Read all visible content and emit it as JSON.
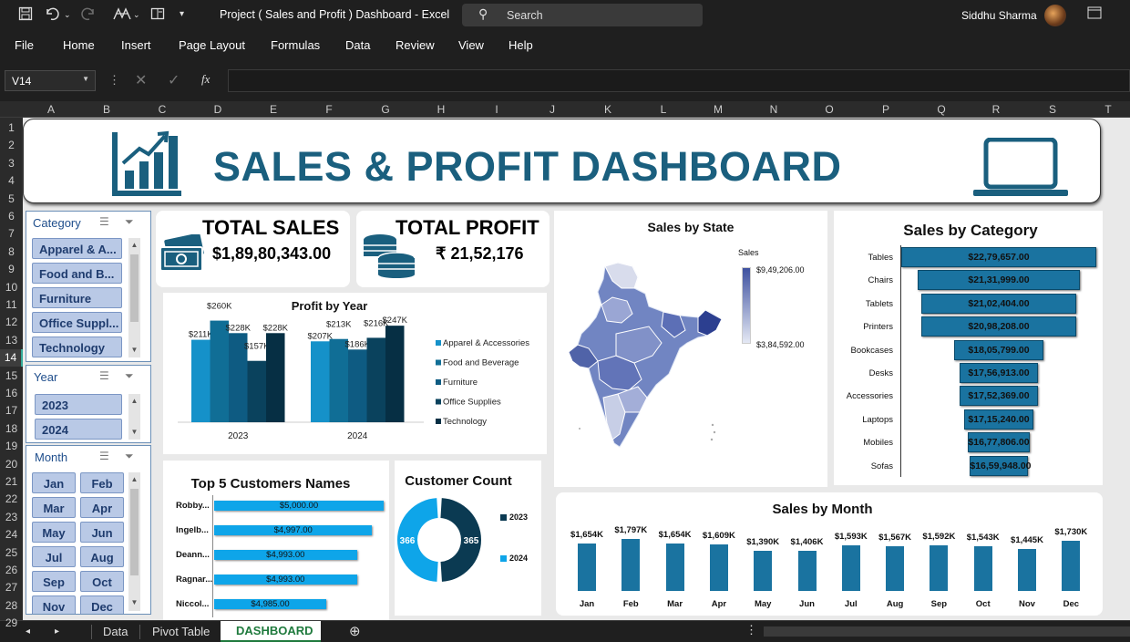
{
  "window": {
    "title": "Project ( Sales and Profit ) Dashboard  -  Excel",
    "search_label": "Search",
    "user_name": "Siddhu Sharma"
  },
  "menu": [
    "File",
    "Home",
    "Insert",
    "Page Layout",
    "Formulas",
    "Data",
    "Review",
    "View",
    "Help"
  ],
  "formula_bar": {
    "name_box": "V14",
    "fx_label": "fx",
    "formula": ""
  },
  "columns": [
    "A",
    "B",
    "C",
    "D",
    "E",
    "F",
    "G",
    "H",
    "I",
    "J",
    "K",
    "L",
    "M",
    "N",
    "O",
    "P",
    "Q",
    "R",
    "S",
    "T"
  ],
  "rows": [
    "1",
    "2",
    "3",
    "4",
    "5",
    "6",
    "7",
    "8",
    "9",
    "10",
    "11",
    "12",
    "13",
    "14",
    "15",
    "16",
    "17",
    "18",
    "19",
    "20",
    "21",
    "22",
    "23",
    "24",
    "25",
    "26",
    "27",
    "28",
    "29"
  ],
  "selected_row": "14",
  "dashboard": {
    "title": "SALES & PROFIT DASHBOARD",
    "total_sales": {
      "label": "TOTAL SALES",
      "value": "$1,89,80,343.00"
    },
    "total_profit": {
      "label": "TOTAL PROFIT",
      "value": "₹ 21,52,176"
    }
  },
  "slicers": {
    "category": {
      "title": "Category",
      "items": [
        "Apparel & A...",
        "Food and B...",
        "Furniture",
        "Office Suppl...",
        "Technology"
      ]
    },
    "year": {
      "title": "Year",
      "items": [
        "2023",
        "2024"
      ]
    },
    "month": {
      "title": "Month",
      "items": [
        "Jan",
        "Feb",
        "Mar",
        "Apr",
        "May",
        "Jun",
        "Jul",
        "Aug",
        "Sep",
        "Oct",
        "Nov",
        "Dec"
      ]
    }
  },
  "colors": {
    "brand": "#1a5f7e",
    "s1": "#1591c9",
    "s2": "#106e96",
    "s3": "#0e5b82",
    "s4": "#0a425d",
    "s5": "#062f44",
    "cat_bar": "#1a73a0",
    "light": "#0ea5e9",
    "dark": "#0b3a52"
  },
  "chart_data": [
    {
      "type": "bar",
      "title": "Profit by Year",
      "categories": [
        "2023",
        "2024"
      ],
      "series": [
        {
          "name": "Apparel & Accessories",
          "values": [
            211,
            207
          ]
        },
        {
          "name": "Food and Beverage",
          "values": [
            260,
            213
          ]
        },
        {
          "name": "Furniture",
          "values": [
            228,
            186
          ]
        },
        {
          "name": "Office Supplies",
          "values": [
            157,
            216
          ]
        },
        {
          "name": "Technology",
          "values": [
            228,
            247
          ]
        }
      ],
      "data_labels": [
        [
          "$211K",
          "$260K",
          "$228K",
          "$157K",
          "$228K"
        ],
        [
          "$207K",
          "$213K",
          "$186K",
          "$216K",
          "$247K"
        ]
      ],
      "ylim": [
        0,
        280
      ]
    },
    {
      "type": "map",
      "title": "Sales by State",
      "legend_title": "Sales",
      "legend_max": "$9,49,206.00",
      "legend_min": "$3,84,592.00"
    },
    {
      "type": "bar",
      "orientation": "horizontal",
      "title": "Sales by Category",
      "categories": [
        "Tables",
        "Chairs",
        "Tablets",
        "Printers",
        "Bookcases",
        "Desks",
        "Accessories",
        "Laptops",
        "Mobiles",
        "Sofas"
      ],
      "values": [
        2279657,
        2131999,
        2102404,
        2098208,
        1805799,
        1756913,
        1752369,
        1715240,
        1677806,
        1659948
      ],
      "labels": [
        "$22,79,657.00",
        "$21,31,999.00",
        "$21,02,404.00",
        "$20,98,208.00",
        "$18,05,799.00",
        "$17,56,913.00",
        "$17,52,369.00",
        "$17,15,240.00",
        "$16,77,806.00",
        "$16,59,948.00"
      ]
    },
    {
      "type": "bar",
      "orientation": "horizontal",
      "title": "Top 5 Customers Names",
      "categories": [
        "Robby...",
        "Ingelb...",
        "Deann...",
        "Ragnar...",
        "Niccol..."
      ],
      "values": [
        5000,
        4997,
        4993,
        4993,
        4985
      ],
      "labels": [
        "$5,000.00",
        "$4,997.00",
        "$4,993.00",
        "$4,993.00",
        "$4,985.00"
      ],
      "xlim": [
        4970,
        5000
      ]
    },
    {
      "type": "pie",
      "title": "Customer Count",
      "categories": [
        "2023",
        "2024"
      ],
      "values": [
        365,
        366
      ]
    },
    {
      "type": "bar",
      "title": "Sales by Month",
      "categories": [
        "Jan",
        "Feb",
        "Mar",
        "Apr",
        "May",
        "Jun",
        "Jul",
        "Aug",
        "Sep",
        "Oct",
        "Nov",
        "Dec"
      ],
      "values": [
        1654,
        1797,
        1654,
        1609,
        1390,
        1406,
        1593,
        1567,
        1592,
        1543,
        1445,
        1730
      ],
      "labels": [
        "$1,654K",
        "$1,797K",
        "$1,654K",
        "$1,609K",
        "$1,390K",
        "$1,406K",
        "$1,593K",
        "$1,567K",
        "$1,592K",
        "$1,543K",
        "$1,445K",
        "$1,730K"
      ]
    }
  ],
  "sheet_tabs": [
    "Data",
    "Pivot Table",
    "DASHBOARD"
  ]
}
